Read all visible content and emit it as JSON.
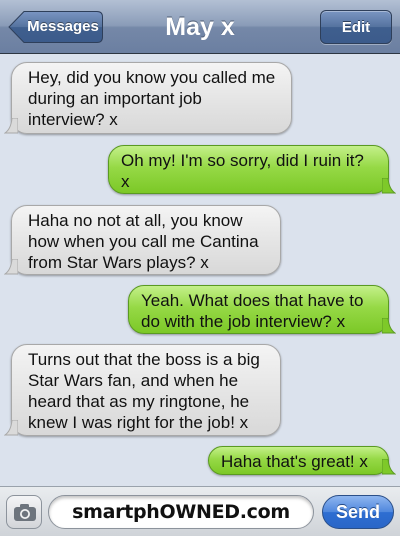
{
  "header": {
    "back_label": "Messages",
    "title": "May x",
    "edit_label": "Edit"
  },
  "messages": [
    {
      "direction": "incoming",
      "text": "Hey, did you know you called me during an important job interview? x"
    },
    {
      "direction": "outgoing",
      "text": "Oh my! I'm so sorry, did I ruin it? x"
    },
    {
      "direction": "incoming",
      "text": "Haha no not at all, you know how when you call me Cantina from Star Wars plays? x"
    },
    {
      "direction": "outgoing",
      "text": "Yeah. What does that have to do with the job interview? x"
    },
    {
      "direction": "incoming",
      "text": "Turns out that the boss is a big Star Wars fan, and when he heard that as my ringtone, he knew I was right for the job! x"
    },
    {
      "direction": "outgoing",
      "text": "Haha that's great! x"
    }
  ],
  "composer": {
    "field_text": "smartphOWNED.com",
    "send_label": "Send",
    "camera_icon": "camera-icon"
  },
  "colors": {
    "incoming_bubble": "#e4e4e4",
    "outgoing_bubble": "#96d946",
    "nav_bar": "#8a9cb8",
    "send_button": "#4f87dd",
    "background": "#dbe2ed"
  }
}
